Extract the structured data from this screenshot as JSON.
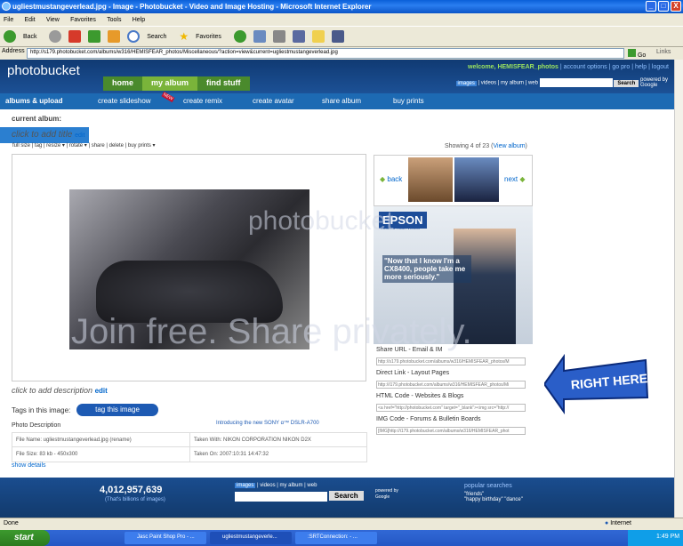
{
  "window": {
    "title": "ugliestmustangeverlead.jpg - Image - Photobucket - Video and Image Hosting - Microsoft Internet Explorer",
    "minimize": "_",
    "maximize": "□",
    "close": "X"
  },
  "menu": [
    "File",
    "Edit",
    "View",
    "Favorites",
    "Tools",
    "Help"
  ],
  "toolbar": {
    "back": "Back",
    "search": "Search",
    "favorites": "Favorites"
  },
  "address": {
    "label": "Address",
    "url": "http://s179.photobucket.com/albums/w316/HEMISFEAR_photos/Miscellaneous/?action=view&current=ugliestmustangeverlead.jpg",
    "go": "Go",
    "links": "Links"
  },
  "header": {
    "logo": "photobucket",
    "tabs": [
      "home",
      "my album",
      "find stuff"
    ],
    "welcome": "welcome, HEMISFEAR_photos",
    "links": [
      "account options",
      "go pro",
      "help",
      "logout"
    ],
    "search_scopes": [
      "images",
      "videos",
      "my album",
      "web"
    ],
    "search_button": "Search",
    "powered_by": "powered by Google"
  },
  "subnav": {
    "items": [
      "albums & upload",
      "create slideshow",
      "create remix",
      "create avatar",
      "share album",
      "buy prints"
    ],
    "new_badge": "NEW"
  },
  "album": {
    "current_label": "current album:",
    "title_prompt": "click to add title",
    "edit": "edit",
    "showing": "Showing 4 of 23",
    "view_album": "View album",
    "tools": [
      "full size",
      "tag",
      "resize",
      "rotate",
      "share",
      "delete",
      "buy prints"
    ]
  },
  "nav": {
    "back": "back",
    "next": "next"
  },
  "watermark": {
    "main": "Join free. Share privately.",
    "logo": "photobucket"
  },
  "ad": {
    "brand": "EPSON",
    "tagline": "EXCEED YOUR VISION",
    "quote": "\"Now that I know I'm a CX8400, people take me more seriously.\""
  },
  "share": [
    {
      "label": "Share URL - Email & IM",
      "value": "http://s179.photobucket.com/albums/w316/HEMISFEAR_photos/M"
    },
    {
      "label": "Direct Link - Layout Pages",
      "value": "http://i179.photobucket.com/albums/w316/HEMISFEAR_photos/Mi"
    },
    {
      "label": "HTML Code - Websites & Blogs",
      "value": "<a href=\"http://photobucket.com\" target=\"_blank\"><img src=\"http://"
    },
    {
      "label": "IMG Code - Forums & Bulletin Boards",
      "value": "[IMG]http://i179.photobucket.com/albums/w316/HEMISFEAR_phot"
    }
  ],
  "annotation": "RIGHT HERE!!",
  "description": {
    "prompt": "click to add description",
    "edit": "edit",
    "tags_label": "Tags in this image:",
    "tag_button": "tag this image",
    "sony": "Introducing the new SONY α™ DSLR-A700"
  },
  "photo_desc": {
    "title": "Photo Description",
    "rows": [
      [
        "File Name: ugliestmustangeverlead.jpg (rename)",
        "Taken With: NIKON CORPORATION NIKON D2X"
      ],
      [
        "File Size: 83 kb - 450x300",
        "Taken On: 2007:10:31 14:47:32"
      ]
    ],
    "show_details": "show details"
  },
  "footer": {
    "count": "4,012,957,639",
    "count_sub": "(That's billions of images)",
    "scopes": [
      "images",
      "videos",
      "my album",
      "web"
    ],
    "search": "Search",
    "powered": "powered by Google",
    "popular_title": "popular searches",
    "popular": "\"friends\"\n\"happy birthday\" \"dance\""
  },
  "status": {
    "left": "Done",
    "zone": "Internet"
  },
  "taskbar": {
    "start": "start",
    "tasks": [
      "Jasc Paint Shop Pro - ...",
      "ugliestmustangeverle...",
      ":SRTConnection: - ..."
    ],
    "clock": "1:49 PM"
  }
}
